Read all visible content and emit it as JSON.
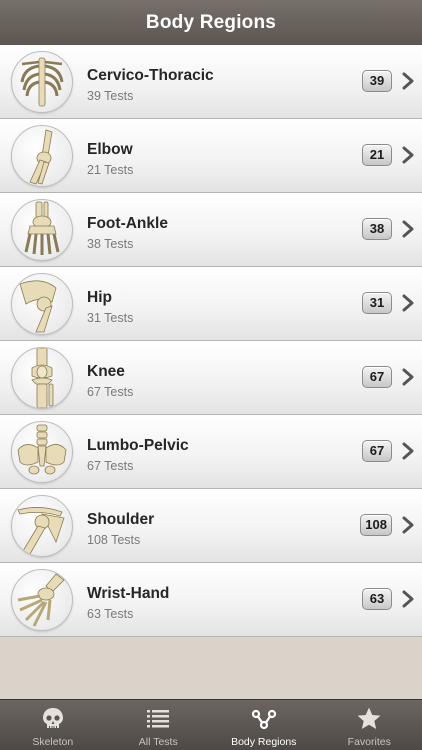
{
  "header": {
    "title": "Body Regions"
  },
  "regions": [
    {
      "name": "Cervico-Thoracic",
      "subtitle": "39 Tests",
      "count": "39",
      "icon": "spine-ribcage-icon"
    },
    {
      "name": "Elbow",
      "subtitle": "21 Tests",
      "count": "21",
      "icon": "elbow-bone-icon"
    },
    {
      "name": "Foot-Ankle",
      "subtitle": "38 Tests",
      "count": "38",
      "icon": "foot-bone-icon"
    },
    {
      "name": "Hip",
      "subtitle": "31 Tests",
      "count": "31",
      "icon": "hip-bone-icon"
    },
    {
      "name": "Knee",
      "subtitle": "67 Tests",
      "count": "67",
      "icon": "knee-bone-icon"
    },
    {
      "name": "Lumbo-Pelvic",
      "subtitle": "67 Tests",
      "count": "67",
      "icon": "pelvis-bone-icon"
    },
    {
      "name": "Shoulder",
      "subtitle": "108 Tests",
      "count": "108",
      "icon": "shoulder-bone-icon"
    },
    {
      "name": "Wrist-Hand",
      "subtitle": "63 Tests",
      "count": "63",
      "icon": "hand-bone-icon"
    }
  ],
  "tabs": [
    {
      "label": "Skeleton",
      "icon": "skull-icon",
      "active": false
    },
    {
      "label": "All Tests",
      "icon": "list-icon",
      "active": false
    },
    {
      "label": "Body Regions",
      "icon": "regions-network-icon",
      "active": true
    },
    {
      "label": "Favorites",
      "icon": "star-icon",
      "active": false
    }
  ],
  "colors": {
    "navbar": "#5c5550",
    "badge_border": "#8b8b8b",
    "background": "#d9d3ca"
  }
}
